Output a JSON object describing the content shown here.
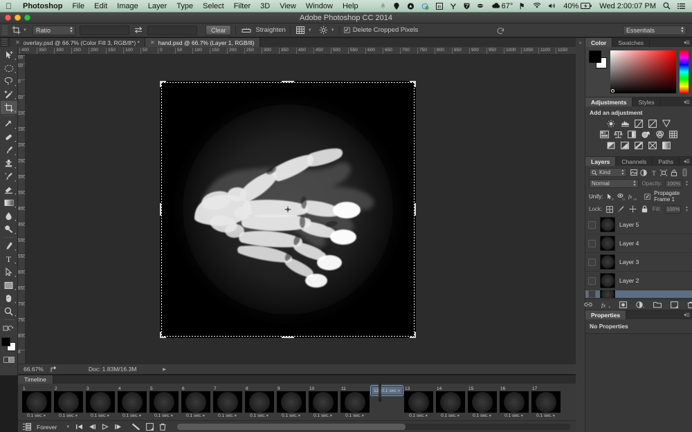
{
  "os_menu": {
    "apple_icon": "apple-icon",
    "items": [
      "Photoshop",
      "File",
      "Edit",
      "Image",
      "Layer",
      "Type",
      "Select",
      "Filter",
      "3D",
      "View",
      "Window",
      "Help"
    ],
    "status_items": [
      {
        "icon": "bell-icon",
        "label": ""
      },
      {
        "icon": "dropbox-icon",
        "label": ""
      },
      {
        "icon": "google-drive-icon",
        "label": ""
      },
      {
        "icon": "sync-icon",
        "label": ""
      },
      {
        "icon": "linkedin-icon",
        "label": ""
      },
      {
        "icon": "antenna-icon",
        "label": ""
      },
      {
        "icon": "shield-icon",
        "label": ""
      },
      {
        "icon": "coffee-icon",
        "label": ""
      },
      {
        "icon": "cloud-icon",
        "label": "67°"
      },
      {
        "icon": "keyboard-flag-icon",
        "label": ""
      },
      {
        "icon": "wifi-icon",
        "label": ""
      },
      {
        "icon": "volume-icon",
        "label": ""
      },
      {
        "icon": "battery-icon",
        "label": "40%"
      },
      {
        "icon": "clock-text",
        "label": "Wed 2:00:07 PM"
      },
      {
        "icon": "search-icon",
        "label": ""
      },
      {
        "icon": "notification-center-icon",
        "label": ""
      }
    ]
  },
  "window": {
    "title": "Adobe Photoshop CC 2014"
  },
  "options_bar": {
    "tool_icon": "crop-tool-icon",
    "ratio_select": "Ratio",
    "width_value": "",
    "width_placeholder": "",
    "swap_icon": "swap-arrows-icon",
    "height_value": "",
    "height_placeholder": "",
    "clear_button": "Clear",
    "straighten_icon": "straighten-icon",
    "straighten_label": "Straighten",
    "grid_overlay_icon": "crop-grid-icon",
    "settings_icon": "gear-icon",
    "delete_cropped_label": "Delete Cropped Pixels",
    "delete_cropped_checked": true,
    "reset_icon": "reset-icon",
    "workspace_select": "Essentials"
  },
  "document_tabs": [
    {
      "label": "overlay.psd @ 66.7% (Color Fill 3, RGB/8*) *",
      "active": false,
      "close_icon": "close-icon"
    },
    {
      "label": "hand.psd @ 66.7% (Layer 1, RGB/8)",
      "active": true,
      "close_icon": "close-icon"
    }
  ],
  "toolbar": {
    "tools": [
      {
        "name": "move-tool",
        "icon": "move-arrow-icon",
        "active": false
      },
      {
        "name": "marquee-tool",
        "icon": "ellipse-marquee-icon",
        "active": false
      },
      {
        "name": "lasso-tool",
        "icon": "lasso-icon",
        "active": false
      },
      {
        "name": "quick-selection-tool",
        "icon": "quick-selection-icon",
        "active": false
      },
      {
        "name": "crop-tool",
        "icon": "crop-icon",
        "active": true
      },
      {
        "name": "eyedropper-tool",
        "icon": "eyedropper-icon",
        "active": false
      },
      {
        "name": "spot-healing-tool",
        "icon": "bandage-icon",
        "active": false
      },
      {
        "name": "brush-tool",
        "icon": "brush-icon",
        "active": false
      },
      {
        "name": "clone-stamp-tool",
        "icon": "stamp-icon",
        "active": false
      },
      {
        "name": "history-brush-tool",
        "icon": "history-brush-icon",
        "active": false
      },
      {
        "name": "eraser-tool",
        "icon": "eraser-icon",
        "active": false
      },
      {
        "name": "gradient-tool",
        "icon": "gradient-icon",
        "active": false
      },
      {
        "name": "blur-tool",
        "icon": "droplet-icon",
        "active": false
      },
      {
        "name": "dodge-tool",
        "icon": "dodge-icon",
        "active": false
      },
      {
        "name": "pen-tool",
        "icon": "pen-icon",
        "active": false
      },
      {
        "name": "type-tool",
        "icon": "type-t-icon",
        "active": false
      },
      {
        "name": "path-selection-tool",
        "icon": "path-arrow-icon",
        "active": false
      },
      {
        "name": "rectangle-tool",
        "icon": "rectangle-icon",
        "active": false
      },
      {
        "name": "hand-tool",
        "icon": "hand-icon",
        "active": false
      },
      {
        "name": "zoom-tool",
        "icon": "magnifier-icon",
        "active": false
      }
    ],
    "edit_toolbar_icon": "edit-toolbar-icon",
    "quickmask_icon": "quick-mask-icon",
    "foreground_color": "#000000",
    "background_color": "#ffffff"
  },
  "rulers": {
    "horizontal_ticks": [
      "400",
      "350",
      "300",
      "250",
      "200",
      "150",
      "100",
      "50",
      "0",
      "50",
      "100",
      "150",
      "200",
      "250",
      "300",
      "350",
      "400",
      "450",
      "500",
      "550",
      "600",
      "650",
      "700",
      "750",
      "800",
      "850",
      "900",
      "950",
      "1000",
      "1050",
      "1100",
      "1150",
      "1"
    ],
    "vertical_ticks": [
      "00",
      "50",
      "0",
      "50",
      "100",
      "150",
      "200",
      "250",
      "300",
      "350",
      "400",
      "450",
      "500",
      "550",
      "600",
      "650",
      "700",
      "750",
      "800",
      "8"
    ]
  },
  "canvas": {
    "image_name": "hand-xray-image",
    "crop_marks": "crop-selection-marquee",
    "center_marker": "crop-center-crosshair"
  },
  "status_bar": {
    "zoom": "66.67%",
    "share_icon": "share-icon",
    "doc_info": "Doc: 1.83M/16.3M",
    "expand_icon": "triangle-right-icon"
  },
  "timeline": {
    "tab_label": "Timeline",
    "frames": [
      {
        "number": "1",
        "duration": "0.1 sec.",
        "selected": false
      },
      {
        "number": "2",
        "duration": "0.1 sec.",
        "selected": false
      },
      {
        "number": "3",
        "duration": "0.1 sec.",
        "selected": false
      },
      {
        "number": "4",
        "duration": "0.1 sec.",
        "selected": false
      },
      {
        "number": "5",
        "duration": "0.1 sec.",
        "selected": false
      },
      {
        "number": "6",
        "duration": "0.1 sec.",
        "selected": false
      },
      {
        "number": "7",
        "duration": "0.1 sec.",
        "selected": false
      },
      {
        "number": "8",
        "duration": "0.1 sec.",
        "selected": false
      },
      {
        "number": "9",
        "duration": "0.1 sec.",
        "selected": false
      },
      {
        "number": "10",
        "duration": "0.1 sec.",
        "selected": false
      },
      {
        "number": "11",
        "duration": "0.1 sec.",
        "selected": false
      },
      {
        "number": "12",
        "duration": "0.1 sec.",
        "selected": true
      },
      {
        "number": "13",
        "duration": "0.1 sec.",
        "selected": false
      },
      {
        "number": "14",
        "duration": "0.1 sec.",
        "selected": false
      },
      {
        "number": "15",
        "duration": "0.1 sec.",
        "selected": false
      },
      {
        "number": "16",
        "duration": "0.1 sec.",
        "selected": false
      },
      {
        "number": "17",
        "duration": "0.1 sec.",
        "selected": false
      }
    ],
    "controls": {
      "convert_icon": "convert-to-video-timeline-icon",
      "loop_value": "Forever",
      "first_frame_icon": "first-frame-icon",
      "prev_frame_icon": "previous-frame-icon",
      "play_icon": "play-icon",
      "next_frame_icon": "next-frame-icon",
      "tween_icon": "tween-icon",
      "duplicate_icon": "duplicate-frame-icon",
      "delete_icon": "trash-icon"
    }
  },
  "color_panel": {
    "tabs": [
      {
        "label": "Color",
        "active": true
      },
      {
        "label": "Swatches",
        "active": false
      }
    ],
    "menu_icon": "panel-menu-icon",
    "foreground": "#000000",
    "background": "#ffffff"
  },
  "adjustments_panel": {
    "tabs": [
      {
        "label": "Adjustments",
        "active": true
      },
      {
        "label": "Styles",
        "active": false
      }
    ],
    "menu_icon": "panel-menu-icon",
    "title": "Add an adjustment",
    "icons_row1": [
      "brightness-contrast-icon",
      "levels-icon",
      "curves-icon",
      "exposure-icon",
      "vibrance-icon"
    ],
    "icons_row2": [
      "hue-saturation-icon",
      "color-balance-icon",
      "black-white-icon",
      "photo-filter-icon",
      "channel-mixer-icon",
      "color-lookup-icon"
    ],
    "icons_row3": [
      "invert-icon",
      "posterize-icon",
      "threshold-icon",
      "selective-color-icon",
      "gradient-map-icon"
    ]
  },
  "layers_panel": {
    "tabs": [
      {
        "label": "Layers",
        "active": true
      },
      {
        "label": "Channels",
        "active": false
      },
      {
        "label": "Paths",
        "active": false
      }
    ],
    "menu_icon": "panel-menu-icon",
    "filter_select": "Kind",
    "filter_search_icon": "search-icon",
    "filter_icons": [
      "pixel-layer-filter-icon",
      "adjustment-layer-filter-icon",
      "type-layer-filter-icon",
      "shape-layer-filter-icon",
      "smart-object-filter-icon"
    ],
    "filter_toggle_icon": "filter-toggle-icon",
    "blend_mode": "Normal",
    "opacity_label": "Opacity:",
    "opacity_value": "100%",
    "unify_label": "Unify:",
    "unify_icons": [
      "unify-position-icon",
      "unify-visibility-icon",
      "unify-style-icon"
    ],
    "propagate_label": "Propagate Frame 1",
    "propagate_checked": true,
    "lock_label": "Lock:",
    "lock_icons": [
      "lock-transparency-icon",
      "lock-image-icon",
      "lock-position-icon",
      "lock-all-icon"
    ],
    "fill_label": "Fill:",
    "fill_value": "100%",
    "layers": [
      {
        "name": "Layer 5",
        "visible": false,
        "selected": false,
        "thumb": "hand-xray-thumb"
      },
      {
        "name": "Layer 4",
        "visible": false,
        "selected": false,
        "thumb": "hand-xray-thumb"
      },
      {
        "name": "Layer 3",
        "visible": false,
        "selected": false,
        "thumb": "hand-xray-thumb"
      },
      {
        "name": "Layer 2",
        "visible": false,
        "selected": false,
        "thumb": "hand-xray-thumb"
      },
      {
        "name": "",
        "visible": false,
        "selected": true,
        "thumb": "hand-xray-thumb"
      }
    ],
    "bottom_icons": [
      "link-layers-icon",
      "layer-style-fx-icon",
      "layer-mask-icon",
      "new-adjustment-layer-icon",
      "new-group-icon",
      "new-layer-icon",
      "delete-layer-icon"
    ]
  },
  "properties_panel": {
    "tab_label": "Properties",
    "menu_icon": "panel-menu-icon",
    "empty_text": "No Properties"
  }
}
